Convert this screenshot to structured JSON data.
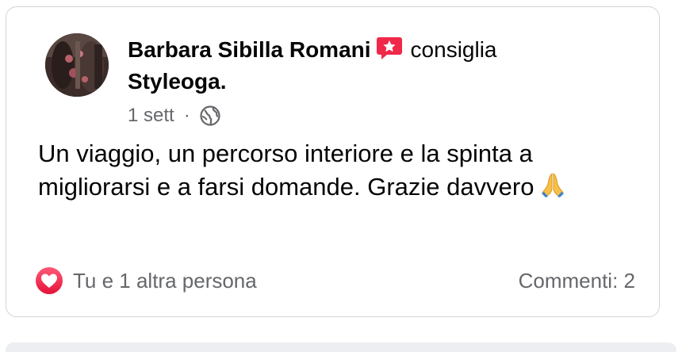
{
  "post": {
    "author": "Barbara Sibilla Romani",
    "recommend_icon": "recommend-star-icon",
    "verb": "consiglia",
    "page_name": "Styleoga.",
    "time": "1 sett",
    "separator": "·",
    "privacy_icon": "globe-icon",
    "text": "Un viaggio, un percorso interiore e la spinta a migliorarsi e a farsi domande. Grazie davvero",
    "emoji_icon": "folded-hands-icon"
  },
  "footer": {
    "reaction_icon": "heart-reaction-icon",
    "reactions_label": "Tu e 1 altra persona",
    "comments_label": "Commenti: 2"
  },
  "colors": {
    "text_primary": "#050505",
    "text_secondary": "#65676b",
    "heart_red": "#f0284a",
    "recommend_red": "#f0284a",
    "card_border": "#d0d3d8"
  }
}
